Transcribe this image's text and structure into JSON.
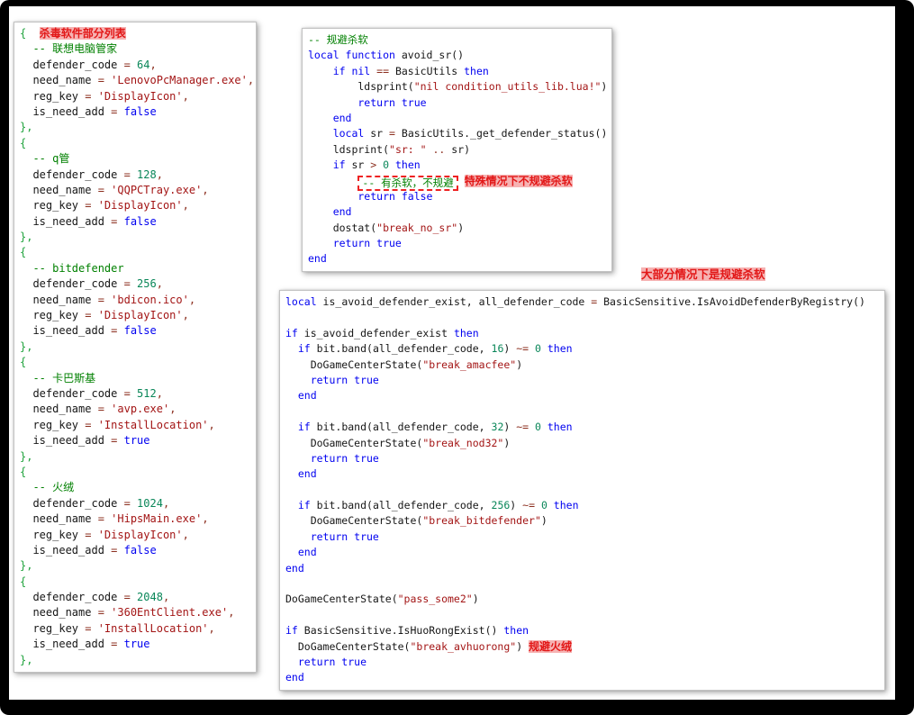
{
  "annotations": {
    "most_note": "大部分情况下是规避杀软"
  },
  "colors": {
    "keyword": "#0000f0",
    "comment": "#008000",
    "string": "#a31515",
    "number": "#098658",
    "annotation_red": "#e21717",
    "annotation_highlight": "#f6b3b3",
    "frame": "#000000",
    "panel_border": "#c3c3c3"
  },
  "panels": {
    "left": {
      "name": "defender-list-code",
      "lines": [
        [
          [
            "br",
            "{"
          ],
          [
            "id",
            "  "
          ],
          [
            "hl",
            "杀毒软件部分列表"
          ]
        ],
        [
          [
            "cm",
            "  -- 联想电脑管家"
          ]
        ],
        [
          [
            "id",
            "  defender_code "
          ],
          [
            "op",
            "= "
          ],
          [
            "num",
            "64"
          ],
          [
            "op",
            ","
          ]
        ],
        [
          [
            "id",
            "  need_name "
          ],
          [
            "op",
            "= "
          ],
          [
            "str",
            "'LenovoPcManager.exe'"
          ],
          [
            "op",
            ","
          ]
        ],
        [
          [
            "id",
            "  reg_key "
          ],
          [
            "op",
            "= "
          ],
          [
            "str",
            "'DisplayIcon'"
          ],
          [
            "op",
            ","
          ]
        ],
        [
          [
            "id",
            "  is_need_add "
          ],
          [
            "op",
            "= "
          ],
          [
            "kw",
            "false"
          ]
        ],
        [
          [
            "br",
            "},"
          ]
        ],
        [
          [
            "br",
            "{"
          ]
        ],
        [
          [
            "cm",
            "  -- q管"
          ]
        ],
        [
          [
            "id",
            "  defender_code "
          ],
          [
            "op",
            "= "
          ],
          [
            "num",
            "128"
          ],
          [
            "op",
            ","
          ]
        ],
        [
          [
            "id",
            "  need_name "
          ],
          [
            "op",
            "= "
          ],
          [
            "str",
            "'QQPCTray.exe'"
          ],
          [
            "op",
            ","
          ]
        ],
        [
          [
            "id",
            "  reg_key "
          ],
          [
            "op",
            "= "
          ],
          [
            "str",
            "'DisplayIcon'"
          ],
          [
            "op",
            ","
          ]
        ],
        [
          [
            "id",
            "  is_need_add "
          ],
          [
            "op",
            "= "
          ],
          [
            "kw",
            "false"
          ]
        ],
        [
          [
            "br",
            "},"
          ]
        ],
        [
          [
            "br",
            "{"
          ]
        ],
        [
          [
            "cm",
            "  -- bitdefender"
          ]
        ],
        [
          [
            "id",
            "  defender_code "
          ],
          [
            "op",
            "= "
          ],
          [
            "num",
            "256"
          ],
          [
            "op",
            ","
          ]
        ],
        [
          [
            "id",
            "  need_name "
          ],
          [
            "op",
            "= "
          ],
          [
            "str",
            "'bdicon.ico'"
          ],
          [
            "op",
            ","
          ]
        ],
        [
          [
            "id",
            "  reg_key "
          ],
          [
            "op",
            "= "
          ],
          [
            "str",
            "'DisplayIcon'"
          ],
          [
            "op",
            ","
          ]
        ],
        [
          [
            "id",
            "  is_need_add "
          ],
          [
            "op",
            "= "
          ],
          [
            "kw",
            "false"
          ]
        ],
        [
          [
            "br",
            "},"
          ]
        ],
        [
          [
            "br",
            "{"
          ]
        ],
        [
          [
            "cm",
            "  -- 卡巴斯基"
          ]
        ],
        [
          [
            "id",
            "  defender_code "
          ],
          [
            "op",
            "= "
          ],
          [
            "num",
            "512"
          ],
          [
            "op",
            ","
          ]
        ],
        [
          [
            "id",
            "  need_name "
          ],
          [
            "op",
            "= "
          ],
          [
            "str",
            "'avp.exe'"
          ],
          [
            "op",
            ","
          ]
        ],
        [
          [
            "id",
            "  reg_key "
          ],
          [
            "op",
            "= "
          ],
          [
            "str",
            "'InstallLocation'"
          ],
          [
            "op",
            ","
          ]
        ],
        [
          [
            "id",
            "  is_need_add "
          ],
          [
            "op",
            "= "
          ],
          [
            "kw",
            "true"
          ]
        ],
        [
          [
            "br",
            "},"
          ]
        ],
        [
          [
            "br",
            "{"
          ]
        ],
        [
          [
            "cm",
            "  -- 火绒"
          ]
        ],
        [
          [
            "id",
            "  defender_code "
          ],
          [
            "op",
            "= "
          ],
          [
            "num",
            "1024"
          ],
          [
            "op",
            ","
          ]
        ],
        [
          [
            "id",
            "  need_name "
          ],
          [
            "op",
            "= "
          ],
          [
            "str",
            "'HipsMain.exe'"
          ],
          [
            "op",
            ","
          ]
        ],
        [
          [
            "id",
            "  reg_key "
          ],
          [
            "op",
            "= "
          ],
          [
            "str",
            "'DisplayIcon'"
          ],
          [
            "op",
            ","
          ]
        ],
        [
          [
            "id",
            "  is_need_add "
          ],
          [
            "op",
            "= "
          ],
          [
            "kw",
            "false"
          ]
        ],
        [
          [
            "br",
            "},"
          ]
        ],
        [
          [
            "br",
            "{"
          ]
        ],
        [
          [
            "id",
            "  defender_code "
          ],
          [
            "op",
            "= "
          ],
          [
            "num",
            "2048"
          ],
          [
            "op",
            ","
          ]
        ],
        [
          [
            "id",
            "  need_name "
          ],
          [
            "op",
            "= "
          ],
          [
            "str",
            "'360EntClient.exe'"
          ],
          [
            "op",
            ","
          ]
        ],
        [
          [
            "id",
            "  reg_key "
          ],
          [
            "op",
            "= "
          ],
          [
            "str",
            "'InstallLocation'"
          ],
          [
            "op",
            ","
          ]
        ],
        [
          [
            "id",
            "  is_need_add "
          ],
          [
            "op",
            "= "
          ],
          [
            "kw",
            "true"
          ]
        ],
        [
          [
            "br",
            "},"
          ]
        ]
      ]
    },
    "top_right": {
      "name": "avoid-sr-function-code",
      "lines": [
        [
          [
            "cm",
            "-- 规避杀软"
          ]
        ],
        [
          [
            "kw",
            "local function "
          ],
          [
            "id",
            "avoid_sr()"
          ]
        ],
        [
          [
            "kw",
            "    if nil "
          ],
          [
            "op",
            "=="
          ],
          [
            "id",
            " BasicUtils "
          ],
          [
            "kw",
            "then"
          ]
        ],
        [
          [
            "id",
            "        ldsprint("
          ],
          [
            "str",
            "\"nil condition_utils_lib.lua!\""
          ],
          [
            "id",
            ")"
          ]
        ],
        [
          [
            "kw",
            "        return true"
          ]
        ],
        [
          [
            "kw",
            "    end"
          ]
        ],
        [
          [
            "kw",
            "    local "
          ],
          [
            "id",
            "sr "
          ],
          [
            "op",
            "= "
          ],
          [
            "id",
            "BasicUtils._get_defender_status()"
          ]
        ],
        [
          [
            "id",
            "    ldsprint("
          ],
          [
            "str",
            "\"sr: \""
          ],
          [
            "op",
            " .. "
          ],
          [
            "id",
            "sr)"
          ]
        ],
        [
          [
            "kw",
            "    if "
          ],
          [
            "id",
            "sr "
          ],
          [
            "op",
            "> "
          ],
          [
            "num",
            "0 "
          ],
          [
            "kw",
            "then"
          ]
        ],
        [
          [
            "id",
            "        "
          ],
          [
            "box",
            "-- 有杀软，不规避"
          ],
          [
            "id",
            " "
          ],
          [
            "hl",
            "特殊情况下不规避杀软"
          ]
        ],
        [
          [
            "kw",
            "        return false"
          ]
        ],
        [
          [
            "kw",
            "    end"
          ]
        ],
        [
          [
            "id",
            "    dostat("
          ],
          [
            "str",
            "\"break_no_sr\""
          ],
          [
            "id",
            ")"
          ]
        ],
        [
          [
            "kw",
            "    return true"
          ]
        ],
        [
          [
            "kw",
            "end"
          ]
        ]
      ]
    },
    "bottom_right": {
      "name": "registry-avoid-code",
      "lines": [
        [
          [
            "kw",
            "local "
          ],
          [
            "id",
            "is_avoid_defender_exist, all_defender_code "
          ],
          [
            "op",
            "= "
          ],
          [
            "id",
            "BasicSensitive.IsAvoidDefenderByRegistry()"
          ]
        ],
        [],
        [
          [
            "kw",
            "if "
          ],
          [
            "id",
            "is_avoid_defender_exist "
          ],
          [
            "kw",
            "then"
          ]
        ],
        [
          [
            "id",
            "  "
          ],
          [
            "kw",
            "if "
          ],
          [
            "id",
            "bit.band(all_defender_code, "
          ],
          [
            "num",
            "16"
          ],
          [
            "id",
            ") "
          ],
          [
            "op",
            "~= "
          ],
          [
            "num",
            "0 "
          ],
          [
            "kw",
            "then"
          ]
        ],
        [
          [
            "id",
            "    DoGameCenterState("
          ],
          [
            "str",
            "\"break_amacfee\""
          ],
          [
            "id",
            ")"
          ]
        ],
        [
          [
            "kw",
            "    return true"
          ]
        ],
        [
          [
            "kw",
            "  end"
          ]
        ],
        [],
        [
          [
            "id",
            "  "
          ],
          [
            "kw",
            "if "
          ],
          [
            "id",
            "bit.band(all_defender_code, "
          ],
          [
            "num",
            "32"
          ],
          [
            "id",
            ") "
          ],
          [
            "op",
            "~= "
          ],
          [
            "num",
            "0 "
          ],
          [
            "kw",
            "then"
          ]
        ],
        [
          [
            "id",
            "    DoGameCenterState("
          ],
          [
            "str",
            "\"break_nod32\""
          ],
          [
            "id",
            ")"
          ]
        ],
        [
          [
            "kw",
            "    return true"
          ]
        ],
        [
          [
            "kw",
            "  end"
          ]
        ],
        [],
        [
          [
            "id",
            "  "
          ],
          [
            "kw",
            "if "
          ],
          [
            "id",
            "bit.band(all_defender_code, "
          ],
          [
            "num",
            "256"
          ],
          [
            "id",
            ") "
          ],
          [
            "op",
            "~= "
          ],
          [
            "num",
            "0 "
          ],
          [
            "kw",
            "then"
          ]
        ],
        [
          [
            "id",
            "    DoGameCenterState("
          ],
          [
            "str",
            "\"break_bitdefender\""
          ],
          [
            "id",
            ")"
          ]
        ],
        [
          [
            "kw",
            "    return true"
          ]
        ],
        [
          [
            "kw",
            "  end"
          ]
        ],
        [
          [
            "kw",
            "end"
          ]
        ],
        [],
        [
          [
            "id",
            "DoGameCenterState("
          ],
          [
            "str",
            "\"pass_some2\""
          ],
          [
            "id",
            ")"
          ]
        ],
        [],
        [
          [
            "kw",
            "if "
          ],
          [
            "id",
            "BasicSensitive.IsHuoRongExist() "
          ],
          [
            "kw",
            "then"
          ]
        ],
        [
          [
            "id",
            "  DoGameCenterState("
          ],
          [
            "str",
            "\"break_avhuorong\""
          ],
          [
            "id",
            ") "
          ],
          [
            "hl",
            "规避火绒"
          ]
        ],
        [
          [
            "kw",
            "  return true"
          ]
        ],
        [
          [
            "kw",
            "end"
          ]
        ]
      ]
    }
  }
}
